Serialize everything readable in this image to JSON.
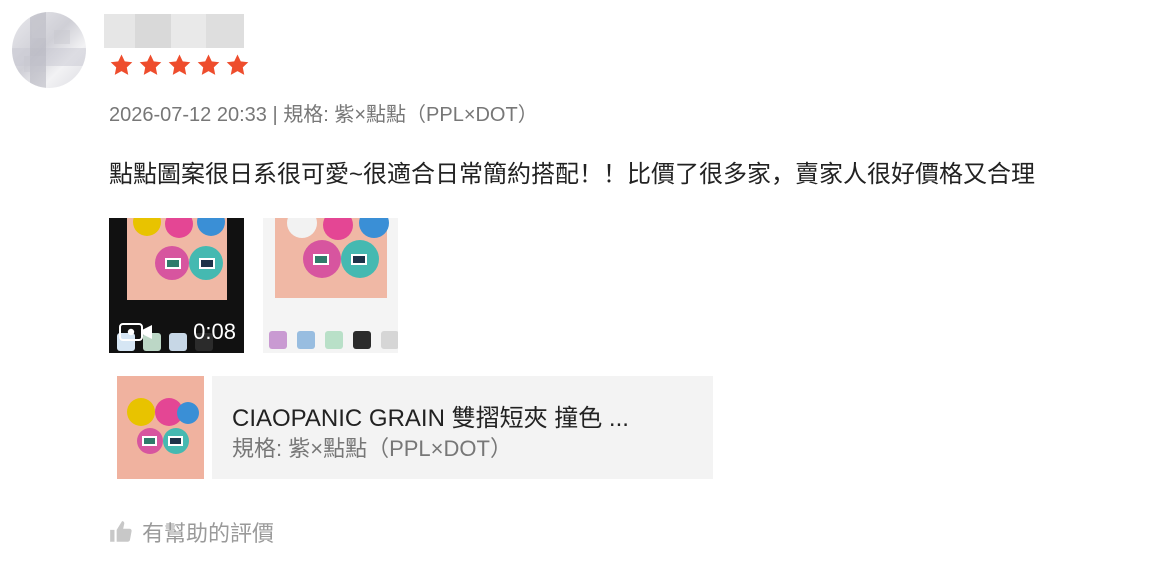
{
  "review": {
    "avatar_icon": "blurred-user-avatar",
    "username": "",
    "rating": {
      "value": 5,
      "max": 5,
      "star_color": "#ee4d2d"
    },
    "meta_line": "2026-07-12 20:33 | 規格: 紫×點點（PPL×DOT）",
    "comment": "點點圖案很日系很可愛~很適合日常簡約搭配！！比價了很多家，賣家人很好價格又合理",
    "media": {
      "video_duration": "0:08",
      "video_icon": "video-camera-icon",
      "photo_icon": "product-photo"
    },
    "product": {
      "title": "CIAOPANIC GRAIN 雙摺短夾 撞色 ...",
      "spec": "規格: 紫×點點（PPL×DOT）"
    },
    "helpful_label": "有幫助的評價",
    "helpful_icon": "thumbs-up-icon"
  }
}
